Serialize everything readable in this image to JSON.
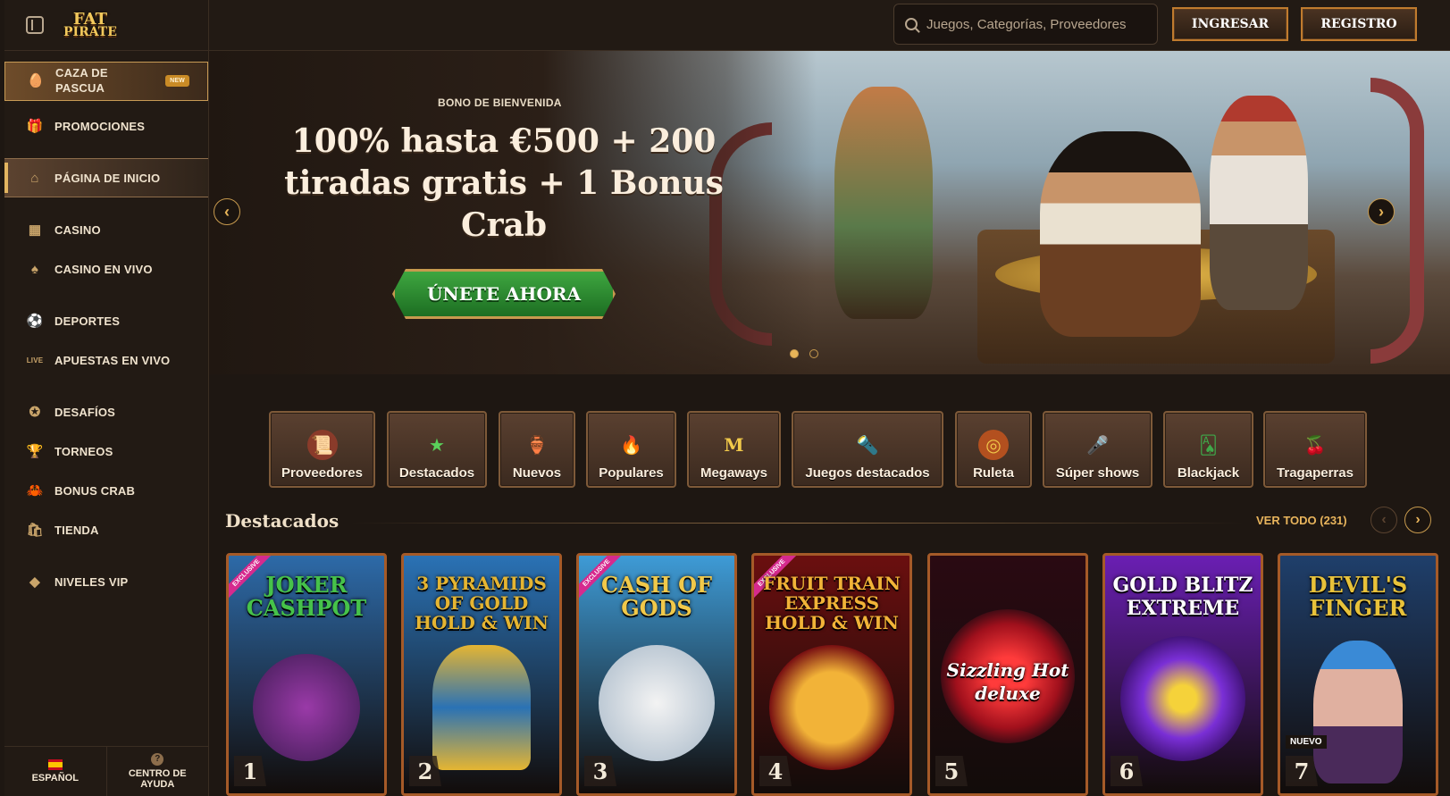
{
  "brand": {
    "logo_line1": "FAT",
    "logo_line2": "PIRATE"
  },
  "header": {
    "search_placeholder": "Juegos, Categorías, Proveedores",
    "login_label": "INGRESAR",
    "register_label": "REGISTRO"
  },
  "sidebar": {
    "items": [
      {
        "label": "CAZA DE PASCUA",
        "icon": "egg-icon",
        "badge": "NEW"
      },
      {
        "label": "PROMOCIONES",
        "icon": "gift-icon"
      },
      {
        "label": "PÁGINA DE INICIO",
        "icon": "home-icon"
      },
      {
        "label": "CASINO",
        "icon": "slot-machine-icon"
      },
      {
        "label": "CASINO EN VIVO",
        "icon": "card-icon"
      },
      {
        "label": "DEPORTES",
        "icon": "soccer-ball-icon"
      },
      {
        "label": "APUESTAS EN VIVO",
        "icon": "live-icon"
      },
      {
        "label": "DESAFÍOS",
        "icon": "medal-icon"
      },
      {
        "label": "TORNEOS",
        "icon": "trophy-icon"
      },
      {
        "label": "BONUS CRAB",
        "icon": "crab-icon"
      },
      {
        "label": "TIENDA",
        "icon": "basket-icon"
      },
      {
        "label": "NIVELES VIP",
        "icon": "diamond-icon"
      }
    ],
    "bottom": {
      "language": "ESPAÑOL",
      "help": "CENTRO DE AYUDA"
    }
  },
  "hero": {
    "subtitle": "BONO DE BIENVENIDA",
    "title": "100% hasta €500 + 200 tiradas gratis + 1 Bonus Crab",
    "cta": "ÚNETE AHORA",
    "slides_total": 2,
    "active_slide": 1
  },
  "categories": [
    {
      "label": "Proveedores",
      "icon": "scroll-icon"
    },
    {
      "label": "Destacados",
      "icon": "star-icon"
    },
    {
      "label": "Nuevos",
      "icon": "goblet-icon"
    },
    {
      "label": "Populares",
      "icon": "flame-gem-icon"
    },
    {
      "label": "Megaways",
      "icon": "m-letter-icon"
    },
    {
      "label": "Juegos destacados",
      "icon": "torch-icon"
    },
    {
      "label": "Ruleta",
      "icon": "roulette-icon"
    },
    {
      "label": "Súper shows",
      "icon": "microphone-icon"
    },
    {
      "label": "Blackjack",
      "icon": "cards-icon"
    },
    {
      "label": "Tragaperras",
      "icon": "cherries-icon"
    }
  ],
  "featured": {
    "title": "Destacados",
    "view_all": "VER TODO (231)",
    "games": [
      {
        "rank": "1",
        "name": "JOKER CASHPOT",
        "exclusive": "EXCLUSIVE",
        "bg": "#2d6aa8",
        "accent": "#46c24a"
      },
      {
        "rank": "2",
        "name": "3 PYRAMIDS OF GOLD HOLD & WIN",
        "bg": "#2a72b5",
        "accent": "#e5b532"
      },
      {
        "rank": "3",
        "name": "CASH OF GODS",
        "exclusive": "EXCLUSIVE",
        "bg": "#3e9bd6",
        "accent": "#f1c94a"
      },
      {
        "rank": "4",
        "name": "FRUIT TRAIN EXPRESS HOLD & WIN",
        "exclusive": "EXCLUSIVE",
        "bg": "#6b0f0f",
        "accent": "#f2b338"
      },
      {
        "rank": "5",
        "name": "Sizzling Hot deluxe",
        "bg": "#2a0a12",
        "accent": "#e0202a"
      },
      {
        "rank": "6",
        "name": "GOLD BLITZ EXTREME",
        "bg": "#6a1fb3",
        "accent": "#f5d23a"
      },
      {
        "rank": "7",
        "name": "DEVIL'S FINGER",
        "badge": "NUEVO",
        "bg": "#1f3f6b",
        "accent": "#e8c23a"
      }
    ]
  }
}
